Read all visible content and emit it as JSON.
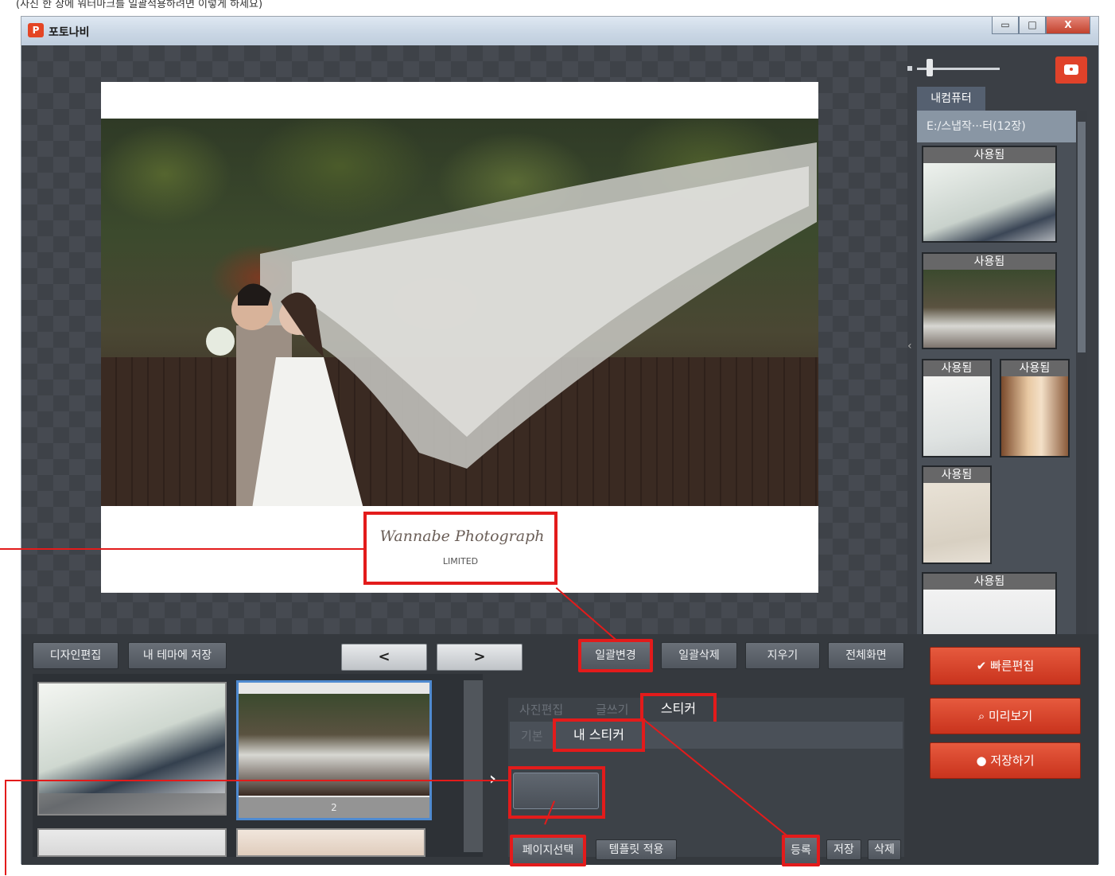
{
  "page_caption": "(사진 한 장에 워터마크를 일괄적용하려면 이렇게 하세요)",
  "window": {
    "app_title": "포토나비",
    "app_logo_letter": "P",
    "controls": {
      "minimize": "▭",
      "maximize": "□",
      "close": "X"
    }
  },
  "canvas": {
    "watermark_script": "Wannabe Photograph",
    "watermark_sub": "LIMITED",
    "collapse_toggle": "⌄⌄"
  },
  "right_panel": {
    "tab_label": "내컴퓨터",
    "folder_path": "E:/스냅작···터(12장)",
    "thumbnails": [
      {
        "label": "사용됨"
      },
      {
        "label": "사용됨"
      },
      {
        "label": "사용됨"
      },
      {
        "label": "사용됨"
      },
      {
        "label": "사용됨"
      },
      {
        "label": "사용됨"
      }
    ],
    "panel_toggle": "‹"
  },
  "toolbar": {
    "design_edit": "디자인편집",
    "save_to_theme": "내 테마에 저장",
    "prev": "<",
    "next": ">",
    "bulk_change": "일괄변경",
    "bulk_delete": "일괄삭제",
    "erase": "지우기",
    "fullscreen": "전체화면"
  },
  "actions": {
    "quick_edit": "빠른편집",
    "preview": "미리보기",
    "save": "저장하기"
  },
  "pages": {
    "items": [
      {
        "num": ""
      },
      {
        "num": "2"
      },
      {
        "num": ""
      },
      {
        "num": ""
      }
    ],
    "expand_arrow": "›"
  },
  "sticker_panel": {
    "tabs": [
      "사진편집",
      "글쓰기",
      "스티커"
    ],
    "subtabs": [
      "기본",
      "내 스티커"
    ],
    "footer": {
      "select_page": "페이지선택",
      "apply_template": "템플릿 적용",
      "register": "등록",
      "save": "저장",
      "delete": "삭제"
    }
  },
  "colors": {
    "highlight": "#e31b1b",
    "accent_button": "#d8432b",
    "selected_page": "#4f8ad0"
  }
}
